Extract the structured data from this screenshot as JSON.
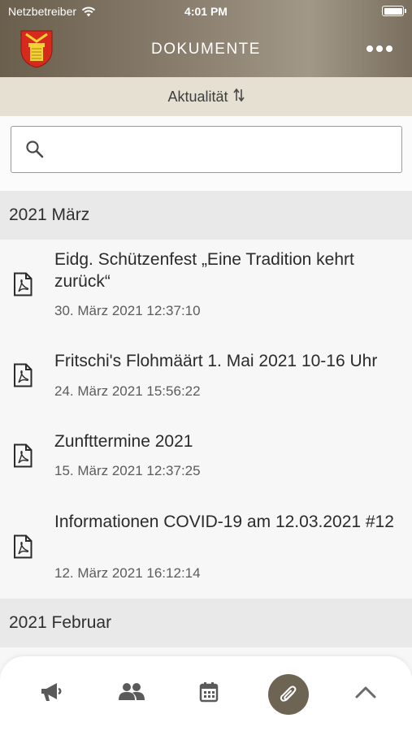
{
  "status_bar": {
    "carrier": "Netzbetreiber",
    "time": "4:01 PM"
  },
  "header": {
    "title": "DOKUMENTE"
  },
  "sort": {
    "label": "Aktualität"
  },
  "search": {
    "placeholder": ""
  },
  "sections": [
    {
      "label": "2021 März"
    },
    {
      "label": "2021 Februar"
    }
  ],
  "documents": [
    {
      "title": "Eidg. Schützenfest „Eine Tradition kehrt zurück“",
      "date": "30. März 2021 12:37:10"
    },
    {
      "title": "Fritschi's Flohmäärt 1. Mai 2021 10-16 Uhr",
      "date": "24. März 2021 15:56:22"
    },
    {
      "title": "Zunfttermine 2021",
      "date": "15. März 2021 12:37:25"
    },
    {
      "title": "Informationen COVID-19 am 12.03.2021 #12",
      "date": "12. März 2021 16:12:14"
    }
  ],
  "tabs": [
    {
      "icon": "megaphone-icon"
    },
    {
      "icon": "users-icon"
    },
    {
      "icon": "calendar-icon"
    },
    {
      "icon": "paperclip-icon",
      "active": true
    },
    {
      "icon": "chevron-up-icon"
    }
  ],
  "colors": {
    "header": "#7d7262",
    "sortbar": "#e6e0d3",
    "section": "#e9e9e9",
    "active_tab": "#6e6454"
  }
}
